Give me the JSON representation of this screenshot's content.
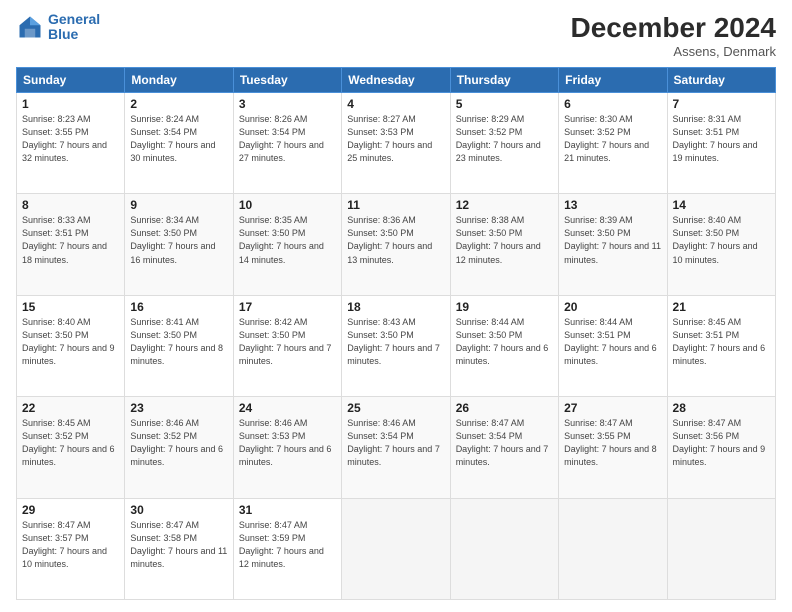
{
  "header": {
    "logo_line1": "General",
    "logo_line2": "Blue",
    "month": "December 2024",
    "location": "Assens, Denmark"
  },
  "days_of_week": [
    "Sunday",
    "Monday",
    "Tuesday",
    "Wednesday",
    "Thursday",
    "Friday",
    "Saturday"
  ],
  "weeks": [
    [
      {
        "day": "1",
        "sunrise": "8:23 AM",
        "sunset": "3:55 PM",
        "daylight": "7 hours and 32 minutes."
      },
      {
        "day": "2",
        "sunrise": "8:24 AM",
        "sunset": "3:54 PM",
        "daylight": "7 hours and 30 minutes."
      },
      {
        "day": "3",
        "sunrise": "8:26 AM",
        "sunset": "3:54 PM",
        "daylight": "7 hours and 27 minutes."
      },
      {
        "day": "4",
        "sunrise": "8:27 AM",
        "sunset": "3:53 PM",
        "daylight": "7 hours and 25 minutes."
      },
      {
        "day": "5",
        "sunrise": "8:29 AM",
        "sunset": "3:52 PM",
        "daylight": "7 hours and 23 minutes."
      },
      {
        "day": "6",
        "sunrise": "8:30 AM",
        "sunset": "3:52 PM",
        "daylight": "7 hours and 21 minutes."
      },
      {
        "day": "7",
        "sunrise": "8:31 AM",
        "sunset": "3:51 PM",
        "daylight": "7 hours and 19 minutes."
      }
    ],
    [
      {
        "day": "8",
        "sunrise": "8:33 AM",
        "sunset": "3:51 PM",
        "daylight": "7 hours and 18 minutes."
      },
      {
        "day": "9",
        "sunrise": "8:34 AM",
        "sunset": "3:50 PM",
        "daylight": "7 hours and 16 minutes."
      },
      {
        "day": "10",
        "sunrise": "8:35 AM",
        "sunset": "3:50 PM",
        "daylight": "7 hours and 14 minutes."
      },
      {
        "day": "11",
        "sunrise": "8:36 AM",
        "sunset": "3:50 PM",
        "daylight": "7 hours and 13 minutes."
      },
      {
        "day": "12",
        "sunrise": "8:38 AM",
        "sunset": "3:50 PM",
        "daylight": "7 hours and 12 minutes."
      },
      {
        "day": "13",
        "sunrise": "8:39 AM",
        "sunset": "3:50 PM",
        "daylight": "7 hours and 11 minutes."
      },
      {
        "day": "14",
        "sunrise": "8:40 AM",
        "sunset": "3:50 PM",
        "daylight": "7 hours and 10 minutes."
      }
    ],
    [
      {
        "day": "15",
        "sunrise": "8:40 AM",
        "sunset": "3:50 PM",
        "daylight": "7 hours and 9 minutes."
      },
      {
        "day": "16",
        "sunrise": "8:41 AM",
        "sunset": "3:50 PM",
        "daylight": "7 hours and 8 minutes."
      },
      {
        "day": "17",
        "sunrise": "8:42 AM",
        "sunset": "3:50 PM",
        "daylight": "7 hours and 7 minutes."
      },
      {
        "day": "18",
        "sunrise": "8:43 AM",
        "sunset": "3:50 PM",
        "daylight": "7 hours and 7 minutes."
      },
      {
        "day": "19",
        "sunrise": "8:44 AM",
        "sunset": "3:50 PM",
        "daylight": "7 hours and 6 minutes."
      },
      {
        "day": "20",
        "sunrise": "8:44 AM",
        "sunset": "3:51 PM",
        "daylight": "7 hours and 6 minutes."
      },
      {
        "day": "21",
        "sunrise": "8:45 AM",
        "sunset": "3:51 PM",
        "daylight": "7 hours and 6 minutes."
      }
    ],
    [
      {
        "day": "22",
        "sunrise": "8:45 AM",
        "sunset": "3:52 PM",
        "daylight": "7 hours and 6 minutes."
      },
      {
        "day": "23",
        "sunrise": "8:46 AM",
        "sunset": "3:52 PM",
        "daylight": "7 hours and 6 minutes."
      },
      {
        "day": "24",
        "sunrise": "8:46 AM",
        "sunset": "3:53 PM",
        "daylight": "7 hours and 6 minutes."
      },
      {
        "day": "25",
        "sunrise": "8:46 AM",
        "sunset": "3:54 PM",
        "daylight": "7 hours and 7 minutes."
      },
      {
        "day": "26",
        "sunrise": "8:47 AM",
        "sunset": "3:54 PM",
        "daylight": "7 hours and 7 minutes."
      },
      {
        "day": "27",
        "sunrise": "8:47 AM",
        "sunset": "3:55 PM",
        "daylight": "7 hours and 8 minutes."
      },
      {
        "day": "28",
        "sunrise": "8:47 AM",
        "sunset": "3:56 PM",
        "daylight": "7 hours and 9 minutes."
      }
    ],
    [
      {
        "day": "29",
        "sunrise": "8:47 AM",
        "sunset": "3:57 PM",
        "daylight": "7 hours and 10 minutes."
      },
      {
        "day": "30",
        "sunrise": "8:47 AM",
        "sunset": "3:58 PM",
        "daylight": "7 hours and 11 minutes."
      },
      {
        "day": "31",
        "sunrise": "8:47 AM",
        "sunset": "3:59 PM",
        "daylight": "7 hours and 12 minutes."
      },
      null,
      null,
      null,
      null
    ]
  ]
}
